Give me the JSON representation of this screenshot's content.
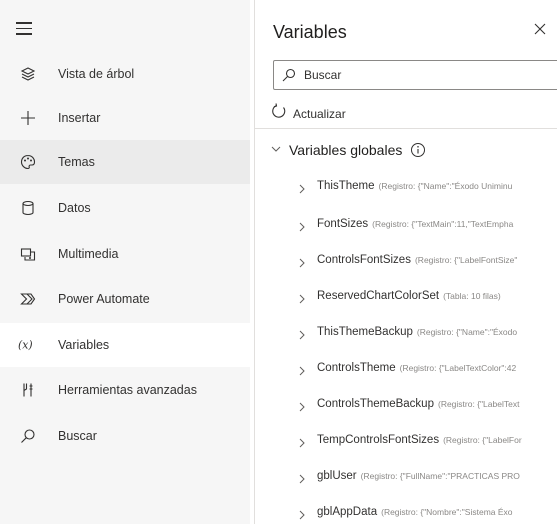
{
  "nav": {
    "items": [
      {
        "label": "Vista de árbol",
        "icon": "layers-icon"
      },
      {
        "label": "Insertar",
        "icon": "plus-icon"
      },
      {
        "label": "Temas",
        "icon": "palette-icon"
      },
      {
        "label": "Datos",
        "icon": "database-icon"
      },
      {
        "label": "Multimedia",
        "icon": "media-icon"
      },
      {
        "label": "Power Automate",
        "icon": "power-automate-icon"
      },
      {
        "label": "Variables",
        "icon": "variables-icon"
      },
      {
        "label": "Herramientas avanzadas",
        "icon": "tools-icon"
      },
      {
        "label": "Buscar",
        "icon": "search-icon"
      }
    ],
    "active_label": "Temas",
    "selected_label": "Variables"
  },
  "panel": {
    "title": "Variables",
    "search_placeholder": "Buscar",
    "refresh_label": "Actualizar",
    "section_label": "Variables globales",
    "variables": [
      {
        "name": "ThisTheme",
        "desc": "(Registro: {\"Name\":\"Éxodo Uniminu"
      },
      {
        "name": "FontSizes",
        "desc": "(Registro: {\"TextMain\":11,\"TextEmpha"
      },
      {
        "name": "ControlsFontSizes",
        "desc": "(Registro: {\"LabelFontSize\""
      },
      {
        "name": "ReservedChartColorSet",
        "desc": "(Tabla: 10 filas)"
      },
      {
        "name": "ThisThemeBackup",
        "desc": "(Registro: {\"Name\":\"Éxodo"
      },
      {
        "name": "ControlsTheme",
        "desc": "(Registro: {\"LabelTextColor\":42"
      },
      {
        "name": "ControlsThemeBackup",
        "desc": "(Registro: {\"LabelText"
      },
      {
        "name": "TempControlsFontSizes",
        "desc": "(Registro: {\"LabelFor"
      },
      {
        "name": "gblUser",
        "desc": "(Registro: {\"FullName\":\"PRACTICAS PRO"
      },
      {
        "name": "gblAppData",
        "desc": "(Registro: {\"Nombre\":\"Sistema Éxo"
      }
    ]
  },
  "colors": {
    "nav_bg": "#f6f6f6",
    "nav_selected_bg": "#ffffff",
    "nav_hover_bg": "#ebebeb",
    "text": "#323130",
    "muted": "#8a8886"
  }
}
